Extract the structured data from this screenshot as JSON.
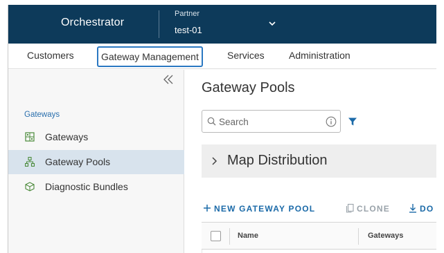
{
  "header": {
    "app_title": "Orchestrator",
    "partner_label": "Partner",
    "partner_value": "test-01"
  },
  "nav": {
    "tabs": [
      {
        "label": "Customers",
        "active": false
      },
      {
        "label": "Gateway Management",
        "active": true
      },
      {
        "label": "Services",
        "active": false
      },
      {
        "label": "Administration",
        "active": false
      }
    ]
  },
  "sidebar": {
    "section_label": "Gateways",
    "items": [
      {
        "label": "Gateways",
        "icon": "gateway-icon",
        "active": false
      },
      {
        "label": "Gateway Pools",
        "icon": "gateway-pools-icon",
        "active": true
      },
      {
        "label": "Diagnostic Bundles",
        "icon": "cube-icon",
        "active": false
      }
    ]
  },
  "main": {
    "title": "Gateway Pools",
    "search": {
      "placeholder": "Search",
      "value": ""
    },
    "map_distribution": "Map Distribution",
    "actions": {
      "new": "NEW GATEWAY POOL",
      "clone": "CLONE",
      "download": "DO"
    },
    "grid": {
      "columns": [
        "Name",
        "Gateways"
      ]
    }
  },
  "colors": {
    "header_bg": "#0d3a5a",
    "accent": "#1b6aa8",
    "active_tab_border": "#2a78c2",
    "sidebar_active": "#d8e3ed"
  }
}
